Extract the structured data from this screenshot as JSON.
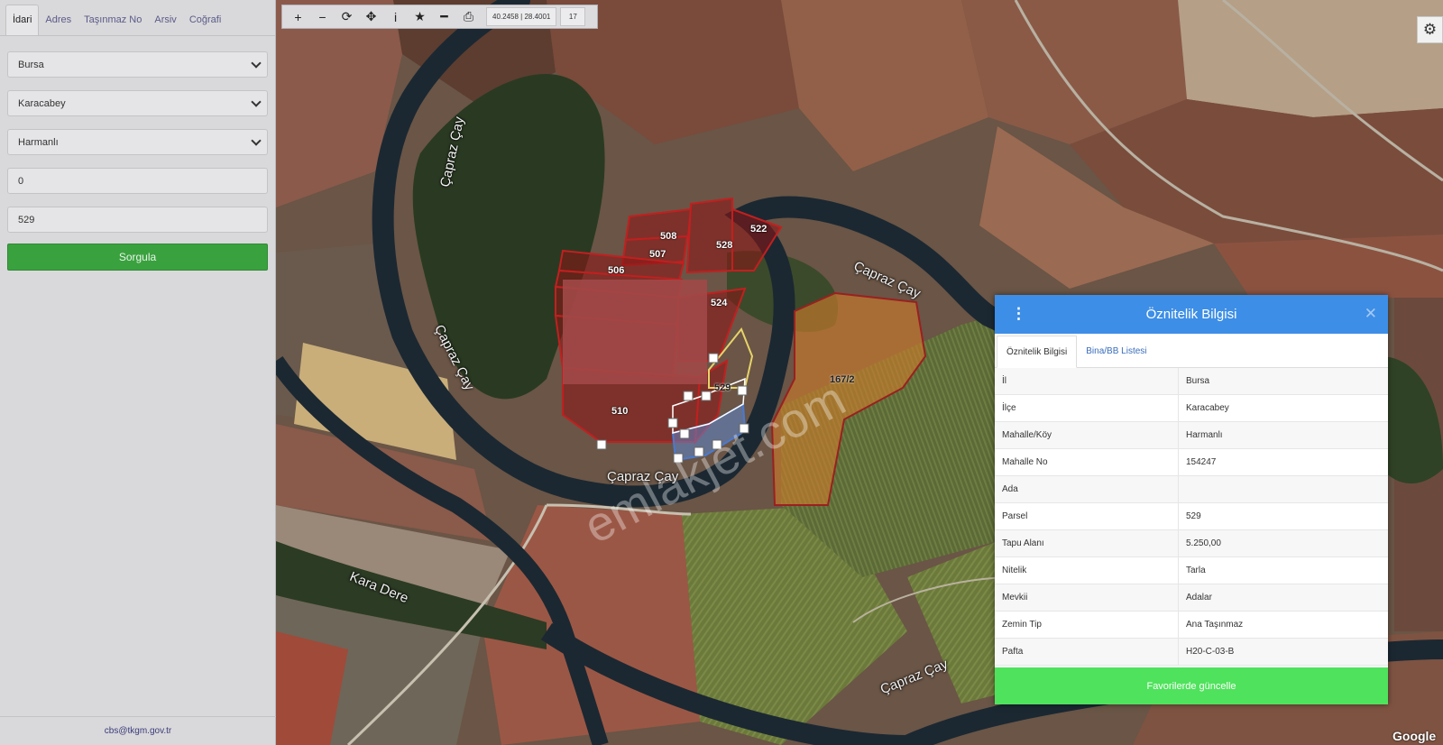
{
  "left_panel": {
    "tabs": [
      "İdari",
      "Adres",
      "Taşınmaz No",
      "Arsiv",
      "Coğrafi"
    ],
    "active_tab": "İdari",
    "fields": {
      "il": "Bursa",
      "ilce": "Karacabey",
      "mahalle": "Harmanlı",
      "ada": "0",
      "parsel": "529"
    },
    "query_button": "Sorgula",
    "footer_email": "cbs@tkgm.gov.tr"
  },
  "toolbar": {
    "buttons": [
      "plus-icon",
      "minus-icon",
      "refresh-icon",
      "locate-icon",
      "info-icon",
      "star-icon",
      "line-icon",
      "print-icon"
    ],
    "glyphs": [
      "+",
      "−",
      "⟳",
      "✥",
      "i",
      "★",
      "━",
      "⎙"
    ],
    "coordinates": "40.2458 | 28.4001",
    "zoom": "17"
  },
  "map": {
    "river_labels": [
      "Çapraz Çay",
      "Çapraz Çay",
      "Çapraz Çay",
      "Çapraz Çay",
      "Kara Dere",
      "Çapraz Çay"
    ],
    "parcel_labels": [
      "508",
      "528",
      "522",
      "507",
      "506",
      "524",
      "529",
      "510",
      "167/2"
    ],
    "watermark": "emlakjet.com",
    "google": "Google"
  },
  "attribute_panel": {
    "title": "Öznitelik Bilgisi",
    "tabs": [
      "Öznitelik Bilgisi",
      "Bina/BB Listesi"
    ],
    "rows": [
      {
        "key": "İl",
        "value": "Bursa"
      },
      {
        "key": "İlçe",
        "value": "Karacabey"
      },
      {
        "key": "Mahalle/Köy",
        "value": "Harmanlı"
      },
      {
        "key": "Mahalle No",
        "value": "154247"
      },
      {
        "key": "Ada",
        "value": ""
      },
      {
        "key": "Parsel",
        "value": "529"
      },
      {
        "key": "Tapu Alanı",
        "value": "5.250,00"
      },
      {
        "key": "Nitelik",
        "value": "Tarla"
      },
      {
        "key": "Mevkii",
        "value": "Adalar"
      },
      {
        "key": "Zemin Tip",
        "value": "Ana Taşınmaz"
      },
      {
        "key": "Pafta",
        "value": "H20-C-03-B"
      }
    ],
    "footer_button": "Favorilerde güncelle"
  }
}
